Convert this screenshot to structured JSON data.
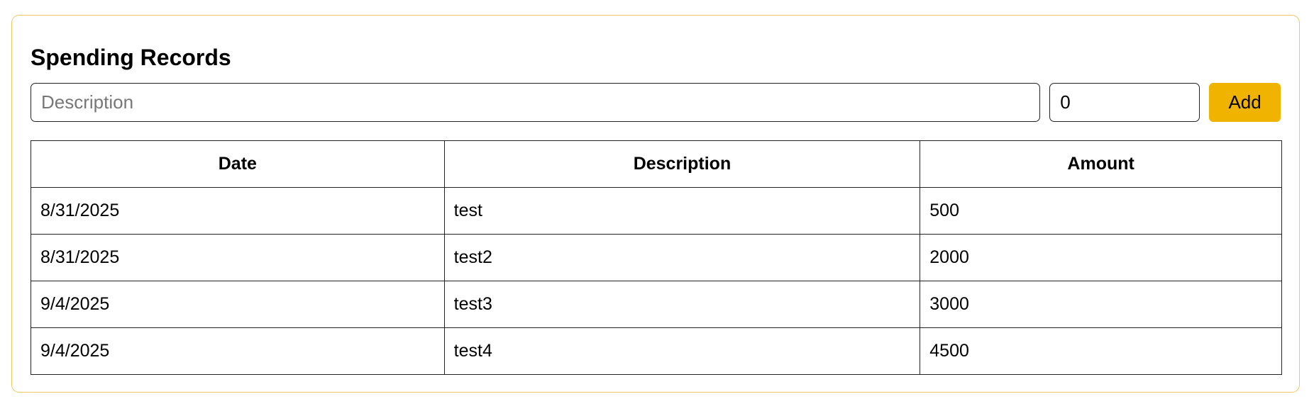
{
  "card": {
    "title": "Spending Records",
    "accent_color": "#f0b400",
    "border_color": "#efc766"
  },
  "form": {
    "description_placeholder": "Description",
    "description_value": "",
    "amount_value": "0",
    "add_label": "Add"
  },
  "table": {
    "headers": {
      "date": "Date",
      "description": "Description",
      "amount": "Amount"
    },
    "rows": [
      {
        "date": "8/31/2025",
        "description": "test",
        "amount": "500"
      },
      {
        "date": "8/31/2025",
        "description": "test2",
        "amount": "2000"
      },
      {
        "date": "9/4/2025",
        "description": "test3",
        "amount": "3000"
      },
      {
        "date": "9/4/2025",
        "description": "test4",
        "amount": "4500"
      }
    ]
  }
}
